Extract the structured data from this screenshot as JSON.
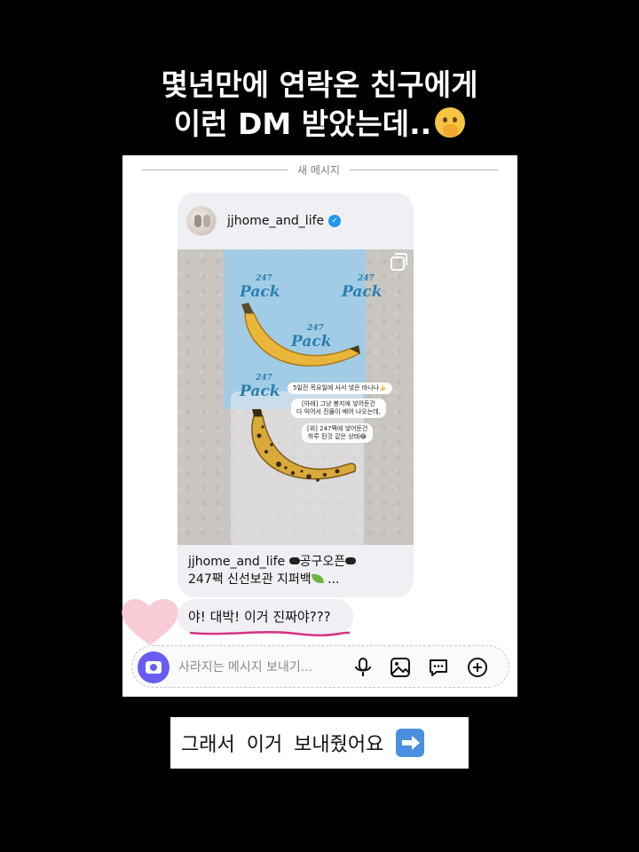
{
  "headline": {
    "line1": "몇년만에 연락온 친구에게",
    "line2": "이런 DM 받았는데..",
    "emoji": "shushing-face-icon"
  },
  "chat": {
    "divider_label": "새 메시지",
    "shared_post": {
      "username": "jjhome_and_life",
      "verified": true,
      "image_labels": {
        "label1": "5일전 목요일에 사서 넣은 바나나🍌",
        "label2_line1": "[아래] 그냥 봉지에 넣어둔건",
        "label2_line2": "다 익어서 진물이 배어 나오는데,",
        "label3_line1": "[위] 247팩에 넣어둔건",
        "label3_line2": "하루 된것 같은 상태😂",
        "bag_brand": "Pack",
        "bag_number": "247"
      },
      "caption_user": "jjhome_and_life",
      "caption_line1_tail": "공구오픈",
      "caption_line2": "247팩 신선보관 지퍼백",
      "caption_more": "..."
    },
    "reply": "야! 대박! 이거 진짜야???",
    "input_placeholder": "사라지는 메시지 보내기..."
  },
  "cta": {
    "label": "그래서 이거 보내줬어요"
  },
  "colors": {
    "background": "#000000",
    "camera_button": "#6a5cf0",
    "verified_badge": "#1e97ef",
    "underline": "#d63384",
    "heart": "#f7c3cf"
  }
}
